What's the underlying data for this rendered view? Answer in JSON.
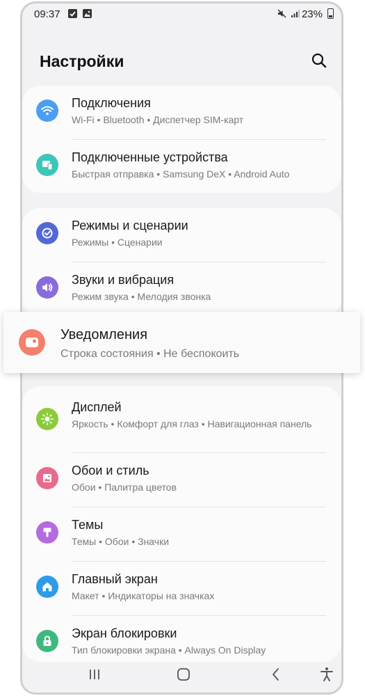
{
  "status_bar": {
    "time": "09:37",
    "battery": "23%"
  },
  "header": {
    "title": "Настройки"
  },
  "groups": [
    {
      "items": [
        {
          "title": "Подключения",
          "subtitle": "Wi-Fi • Bluetooth • Диспетчер SIM-карт",
          "icon": "wifi-icon",
          "color": "#4b9ef3"
        },
        {
          "title": "Подключенные устройства",
          "subtitle": "Быстрая отправка • Samsung DeX • Android Auto",
          "icon": "devices-icon",
          "color": "#3cc6b9"
        }
      ]
    },
    {
      "items": [
        {
          "title": "Режимы и сценарии",
          "subtitle": "Режимы • Сценарии",
          "icon": "modes-icon",
          "color": "#5368d6"
        },
        {
          "title": "Звуки и вибрация",
          "subtitle": "Режим звука • Мелодия звонка",
          "icon": "sound-icon",
          "color": "#8a6bdc"
        }
      ]
    },
    {
      "items": [
        {
          "title": "Дисплей",
          "subtitle": "Яркость • Комфорт для глаз • Навигационная панель",
          "icon": "display-icon",
          "color": "#8acb3a"
        },
        {
          "title": "Обои и стиль",
          "subtitle": "Обои • Палитра цветов",
          "icon": "wallpaper-icon",
          "color": "#e86a8d"
        },
        {
          "title": "Темы",
          "subtitle": "Темы • Обои • Значки",
          "icon": "themes-icon",
          "color": "#b56be0"
        },
        {
          "title": "Главный экран",
          "subtitle": "Макет • Индикаторы на значках",
          "icon": "home-icon",
          "color": "#2f9be8"
        },
        {
          "title": "Экран блокировки",
          "subtitle": "Тип блокировки экрана • Always On Display",
          "icon": "lock-icon",
          "color": "#3fb87e"
        }
      ]
    }
  ],
  "highlight": {
    "title": "Уведомления",
    "subtitle": "Строка состояния • Не беспокоить",
    "icon": "notifications-icon",
    "color": "#f47f6c"
  }
}
